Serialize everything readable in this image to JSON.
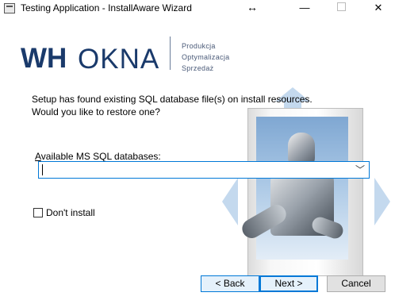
{
  "window": {
    "title": "Testing Application - InstallAware Wizard",
    "resize_glyph": "↔",
    "minimize_glyph": "—",
    "close_glyph": "✕"
  },
  "logo": {
    "brand_bold": "WH",
    "brand_light": "OKNA",
    "taglines": [
      "Produkcja",
      "Optymalizacja",
      "Sprzedaż"
    ]
  },
  "message": {
    "line1": "Setup has found existing SQL database file(s) on install resources.",
    "line2": "Would you like to restore one?"
  },
  "databases": {
    "label_first": "A",
    "label_rest": "vailable MS SQL databases:",
    "selected_value": "",
    "chevron": "﹀"
  },
  "dont_install": {
    "label": "Don't install",
    "checked": false
  },
  "buttons": {
    "back": "< Back",
    "next": "Next >",
    "cancel": "Cancel"
  },
  "colors": {
    "accent": "#0078d7",
    "brand": "#1a3a6b",
    "button_face": "#e1e1e1"
  }
}
